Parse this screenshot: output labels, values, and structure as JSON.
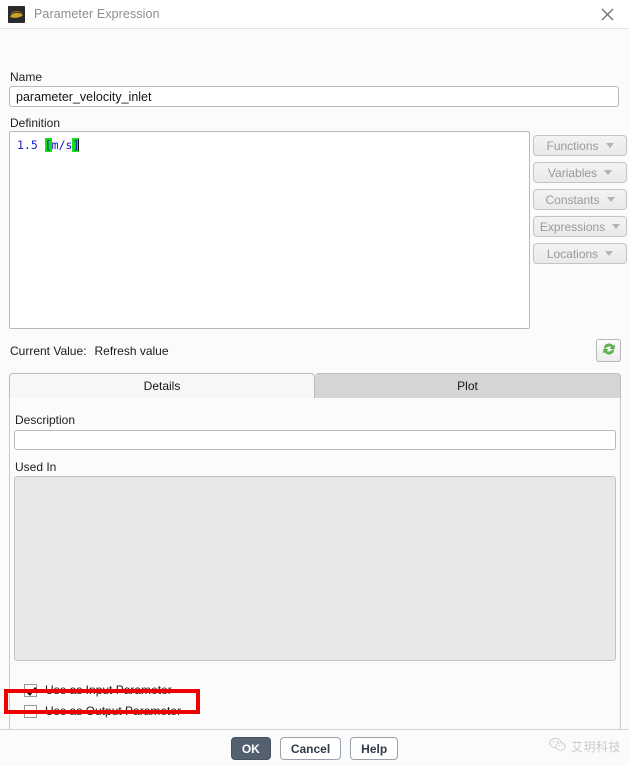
{
  "window": {
    "title": "Parameter Expression",
    "icon": "app-icon",
    "close_icon": "close-icon"
  },
  "form": {
    "name_label": "Name",
    "name_value": "parameter_velocity_inlet",
    "definition_label": "Definition",
    "definition": {
      "number": "1.5",
      "open_bracket": "[",
      "unit": "m/s",
      "close_bracket": "]",
      "full_text": "1.5 [m/s]"
    }
  },
  "insert_buttons": [
    {
      "label": "Functions",
      "icon": "chevron-down-icon"
    },
    {
      "label": "Variables",
      "icon": "chevron-down-icon"
    },
    {
      "label": "Constants",
      "icon": "chevron-down-icon"
    },
    {
      "label": "Expressions",
      "icon": "chevron-down-icon"
    },
    {
      "label": "Locations",
      "icon": "chevron-down-icon"
    }
  ],
  "current_value": {
    "label": "Current Value:",
    "value": "Refresh value",
    "refresh_icon": "refresh-icon"
  },
  "tabs": [
    {
      "label": "Details",
      "active": true
    },
    {
      "label": "Plot",
      "active": false
    }
  ],
  "details": {
    "description_label": "Description",
    "description_value": "",
    "description_placeholder": "",
    "used_in_label": "Used In",
    "used_in_items": []
  },
  "checkboxes": [
    {
      "label": "Use as Input Parameter",
      "checked": true
    },
    {
      "label": "Use as Output Parameter",
      "checked": false
    }
  ],
  "footer_buttons": [
    {
      "label": "OK",
      "style": "default"
    },
    {
      "label": "Cancel",
      "style": "normal"
    },
    {
      "label": "Help",
      "style": "normal"
    }
  ],
  "watermark": {
    "text": "艾玥科技",
    "icon": "wechat-icon"
  },
  "colors": {
    "annotation": "#ee0000",
    "accent_button": "#53606e",
    "syntax_number": "#2222cc",
    "syntax_bracket_highlight": "#16e016",
    "refresh_icon_green": "#54b54a"
  }
}
